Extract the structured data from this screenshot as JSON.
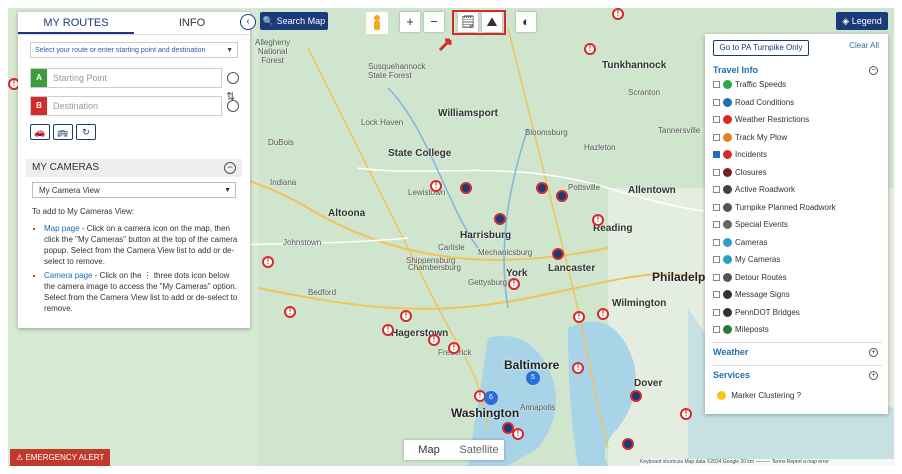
{
  "left_panel": {
    "tabs": [
      "MY ROUTES",
      "INFO"
    ],
    "route_select_placeholder": "Select your route or enter starting point and destination",
    "start": {
      "badge": "A",
      "placeholder": "Starting Point"
    },
    "destination": {
      "badge": "B",
      "placeholder": "Destination"
    },
    "my_cameras": {
      "title": "MY CAMERAS",
      "selected_view": "My Camera View",
      "intro": "To add to My Cameras View:",
      "steps": [
        {
          "link": "Map page",
          "text": " - Click on a camera icon on the map, then click the \"My Cameras\" button at the top of the camera popup. Select from the Camera View list to add or de-select to remove."
        },
        {
          "link": "Camera page",
          "text": " - Click on the ⋮ three dots icon below the camera image to access the \"My Cameras\" option. Select from the Camera View list to add or de-select to remove."
        }
      ]
    }
  },
  "toolbar": {
    "search_map": "Search Map",
    "legend": "Legend"
  },
  "right_panel": {
    "pa_turnpike": "Go to PA Turnpike Only",
    "clear_all": "Clear All",
    "travel_info": "Travel Info",
    "layers": [
      {
        "label": "Traffic Speeds",
        "checked": false,
        "icon": "traffic-speeds-icon",
        "color": "#2aa84a"
      },
      {
        "label": "Road Conditions",
        "checked": false,
        "icon": "road-conditions-icon",
        "color": "#1f6fb2"
      },
      {
        "label": "Weather Restrictions",
        "checked": false,
        "icon": "weather-restrictions-icon",
        "color": "#d62b2b"
      },
      {
        "label": "Track My Plow",
        "checked": false,
        "icon": "plow-icon",
        "color": "#e67e22"
      },
      {
        "label": "Incidents",
        "checked": true,
        "icon": "incident-icon",
        "color": "#d62b2b"
      },
      {
        "label": "Closures",
        "checked": false,
        "icon": "closure-icon",
        "color": "#7a1f1f"
      },
      {
        "label": "Active Roadwork",
        "checked": false,
        "icon": "roadwork-icon",
        "color": "#444444"
      },
      {
        "label": "Turnpike Planned Roadwork",
        "checked": false,
        "icon": "turnpike-roadwork-icon",
        "color": "#555555"
      },
      {
        "label": "Special Events",
        "checked": false,
        "icon": "special-events-icon",
        "color": "#666666"
      },
      {
        "label": "Cameras",
        "checked": false,
        "icon": "camera-icon",
        "color": "#2aa0c8"
      },
      {
        "label": "My Cameras",
        "checked": false,
        "icon": "my-cameras-icon",
        "color": "#2aa0c8"
      },
      {
        "label": "Detour Routes",
        "checked": false,
        "icon": "detour-icon",
        "color": "#555555"
      },
      {
        "label": "Message Signs",
        "checked": false,
        "icon": "message-sign-icon",
        "color": "#333333"
      },
      {
        "label": "PennDOT Bridges",
        "checked": false,
        "icon": "bridge-icon",
        "color": "#333333"
      },
      {
        "label": "Mileposts",
        "checked": false,
        "icon": "milepost-icon",
        "color": "#2a7a3a"
      }
    ],
    "weather": "Weather",
    "services": "Services",
    "marker_clustering": "Marker Clustering"
  },
  "map": {
    "labels": {
      "allegheny": "Allegheny\nNational\nForest",
      "susquehannock": "Susquehannock\nState Forest",
      "tunkhannock": "Tunkhannock",
      "lock_haven": "Lock Haven",
      "williamsport": "Williamsport",
      "bloomsburg": "Bloomsburg",
      "hazleton": "Hazleton",
      "state_college": "State College",
      "lewistown": "Lewistown",
      "allentown": "Allentown",
      "harrisburg": "Harrisburg",
      "lancaster": "Lancaster",
      "philadelphia": "Philadelphia",
      "york": "York",
      "wilmington": "Wilmington",
      "baltimore": "Baltimore",
      "washington": "Washington",
      "hagerstown": "Hagerstown",
      "frederick": "Frederick",
      "dover": "Dover",
      "annapolis": "Annapolis",
      "chambersburg": "Chambersburg",
      "gettysburg": "Gettysburg",
      "dubois": "DuBois",
      "altoona": "Altoona",
      "johnstown": "Johnstown",
      "pottsville": "Pottsville",
      "reading": "Reading",
      "carlisle": "Carlisle",
      "shippensburg": "Shippensburg",
      "mechanicsburg": "Mechanicsburg",
      "bedford": "Bedford",
      "indiana": "Indiana",
      "tannersville": "Tannersville",
      "scranton": "Scranton"
    },
    "clusters": [
      "5",
      "6"
    ],
    "map_type": [
      "Map",
      "Satellite"
    ],
    "emergency_alert": "EMERGENCY ALERT",
    "attribution": "Keyboard shortcuts   Map data ©2024 Google   20 km ———   Terms   Report a map error"
  }
}
